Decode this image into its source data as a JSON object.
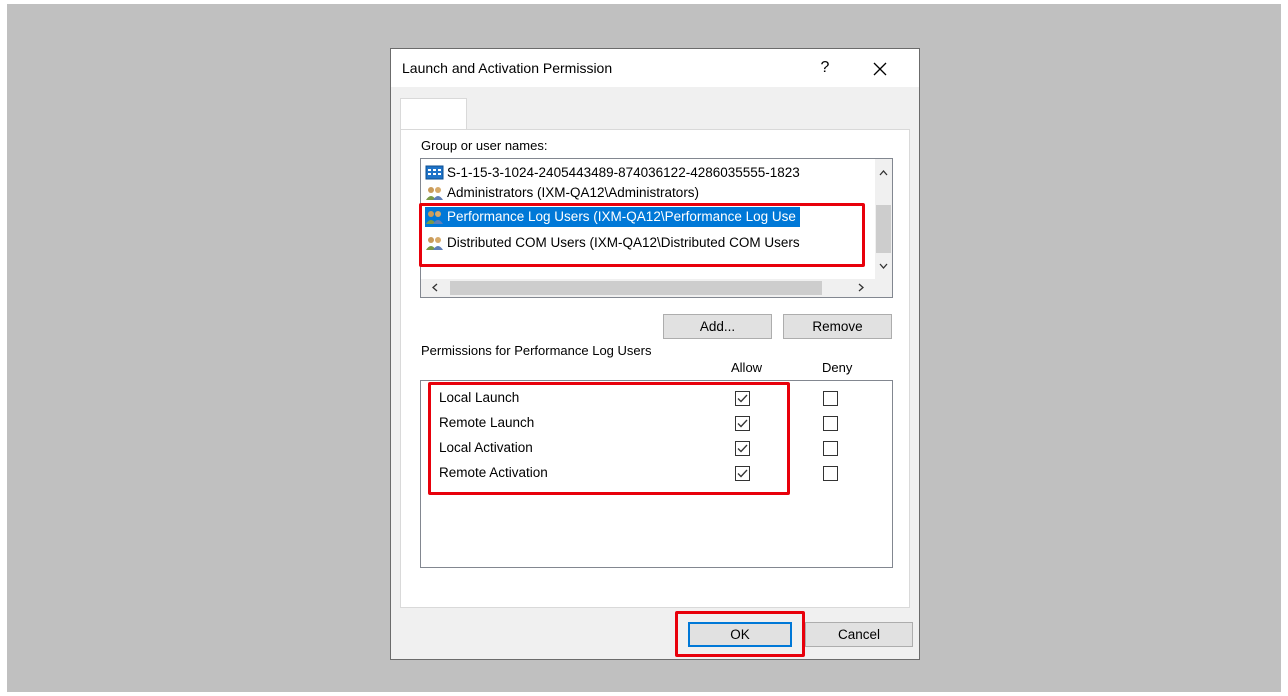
{
  "dialog": {
    "title": "Launch and Activation Permission",
    "help_label": "?",
    "close_label": "✕"
  },
  "groups": {
    "label": "Group or user names:",
    "items": [
      {
        "name": "S-1-15-3-1024-2405443489-874036122-4286035555-1823",
        "icon": "package-sid-icon",
        "selected": false
      },
      {
        "name": "Administrators (IXM-QA12\\Administrators)",
        "icon": "users-group-icon",
        "selected": false
      },
      {
        "name": "Performance Log Users (IXM-QA12\\Performance Log Use",
        "icon": "users-group-icon",
        "selected": true
      },
      {
        "name": "Distributed COM Users (IXM-QA12\\Distributed COM Users",
        "icon": "users-group-icon",
        "selected": false
      }
    ],
    "add_label": "Add...",
    "remove_label": "Remove"
  },
  "permissions": {
    "label": "Permissions for Performance Log Users",
    "allow_header": "Allow",
    "deny_header": "Deny",
    "rows": [
      {
        "name": "Local Launch",
        "allow": true,
        "deny": false
      },
      {
        "name": "Remote Launch",
        "allow": true,
        "deny": false
      },
      {
        "name": "Local Activation",
        "allow": true,
        "deny": false
      },
      {
        "name": "Remote Activation",
        "allow": true,
        "deny": false
      }
    ]
  },
  "footer": {
    "ok_label": "OK",
    "cancel_label": "Cancel"
  },
  "colors": {
    "selection": "#0078d7",
    "highlight": "#e8000b",
    "desktop": "#c0c0c0"
  }
}
